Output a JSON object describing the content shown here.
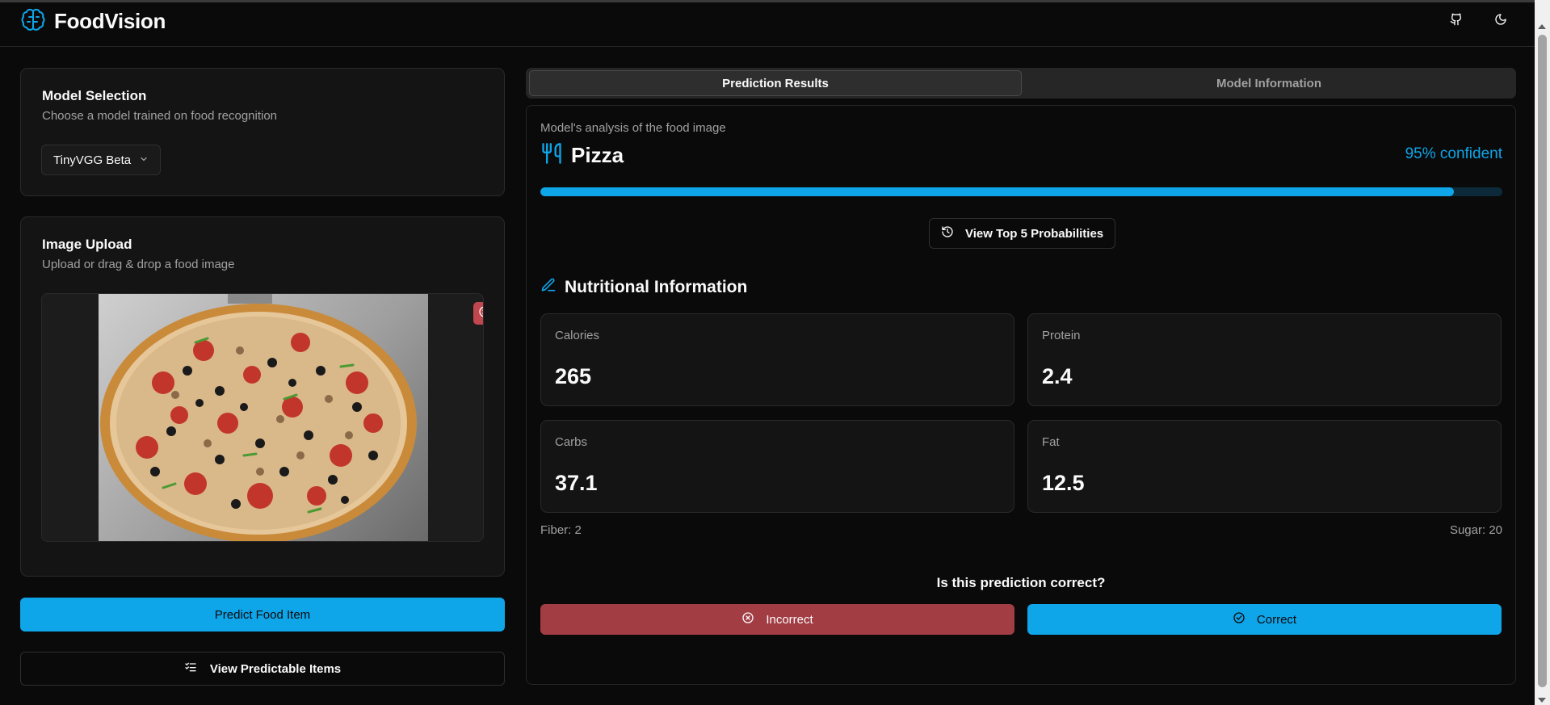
{
  "app": {
    "title": "FoodVision",
    "icons": {
      "logo": "brain-icon",
      "github": "github-icon",
      "theme": "moon-icon"
    }
  },
  "model_selection": {
    "title": "Model Selection",
    "description": "Choose a model trained on food recognition",
    "selected_model": "TinyVGG Beta"
  },
  "image_upload": {
    "title": "Image Upload",
    "description": "Upload or drag & drop a food image"
  },
  "actions": {
    "predict_label": "Predict Food Item",
    "view_items_label": "View Predictable Items"
  },
  "tabs": [
    {
      "label": "Prediction Results",
      "active": true
    },
    {
      "label": "Model Information",
      "active": false
    }
  ],
  "results": {
    "analysis_label": "Model's analysis of the food image",
    "prediction": "Pizza",
    "confidence_text": "95% confident",
    "confidence_value": 0.95,
    "top5_label": "View Top 5 Probabilities",
    "nutrition_heading": "Nutritional Information",
    "nutrition": [
      {
        "label": "Calories",
        "value": "265"
      },
      {
        "label": "Protein",
        "value": "2.4"
      },
      {
        "label": "Carbs",
        "value": "37.1"
      },
      {
        "label": "Fat",
        "value": "12.5"
      }
    ],
    "fiber_text": "Fiber: 2",
    "sugar_text": "Sugar: 20",
    "feedback_question": "Is this prediction correct?",
    "incorrect_label": "Incorrect",
    "correct_label": "Correct"
  },
  "colors": {
    "accent": "#0ea5e9",
    "danger": "#a23d44",
    "background": "#0a0a0a",
    "card": "#141414"
  }
}
